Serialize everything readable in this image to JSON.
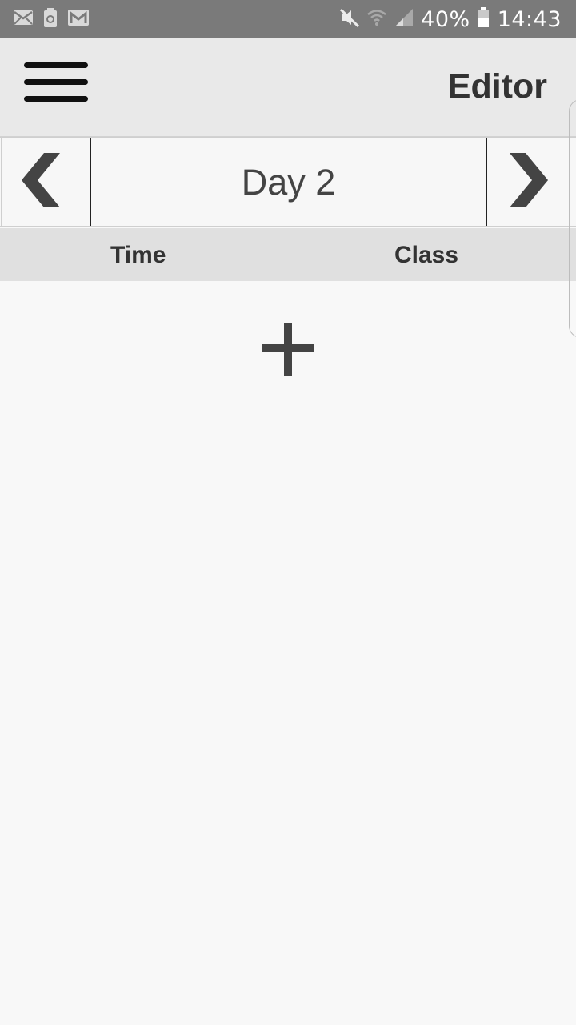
{
  "status_bar": {
    "battery_percent": "40%",
    "time": "14:43",
    "left_icons": [
      "mail-icon",
      "battery-recycle-icon",
      "gmail-icon"
    ],
    "right_icons": [
      "mute-icon",
      "wifi-icon",
      "signal-icon",
      "battery-icon"
    ]
  },
  "app_bar": {
    "title": "Editor",
    "menu_icon": "hamburger-menu-icon"
  },
  "day_nav": {
    "label": "Day 2",
    "prev_icon": "chevron-left-icon",
    "next_icon": "chevron-right-icon"
  },
  "table_header": {
    "time": "Time",
    "class": "Class"
  },
  "add_button": {
    "icon": "plus-icon"
  },
  "colors": {
    "status_bar_bg": "#7a7a7a",
    "app_bar_bg": "#e9e9e9",
    "header_bg": "#e0e0e0",
    "page_bg": "#f8f8f8",
    "icon_dark": "#444444"
  }
}
